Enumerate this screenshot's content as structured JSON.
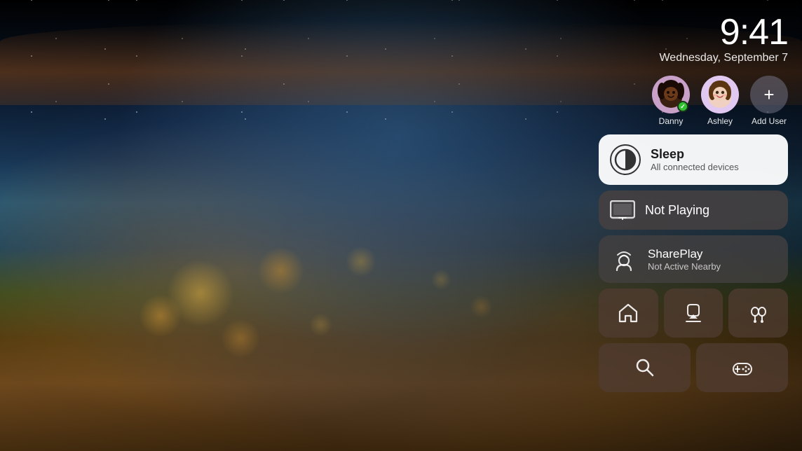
{
  "background": {
    "alt": "Earth from space view"
  },
  "header": {
    "time": "9:41",
    "date": "Wednesday, September 7"
  },
  "users": [
    {
      "name": "Danny",
      "emoji": "🧑🏿",
      "active": true,
      "id": "danny"
    },
    {
      "name": "Ashley",
      "emoji": "🧑",
      "active": false,
      "id": "ashley"
    }
  ],
  "add_user_label": "+",
  "add_user_name": "Add User",
  "cards": {
    "sleep": {
      "title": "Sleep",
      "subtitle": "All connected devices"
    },
    "not_playing": {
      "label": "Not Playing"
    },
    "shareplay": {
      "title": "SharePlay",
      "subtitle": "Not Active Nearby"
    }
  },
  "grid_buttons": [
    {
      "id": "home",
      "icon": "home",
      "label": "Home"
    },
    {
      "id": "airplay",
      "icon": "airplay",
      "label": "AirPlay"
    },
    {
      "id": "airpods",
      "icon": "airpods",
      "label": "AirPods"
    },
    {
      "id": "search",
      "icon": "search",
      "label": "Search"
    },
    {
      "id": "gamepad",
      "icon": "gamepad",
      "label": "Game Controller"
    }
  ]
}
